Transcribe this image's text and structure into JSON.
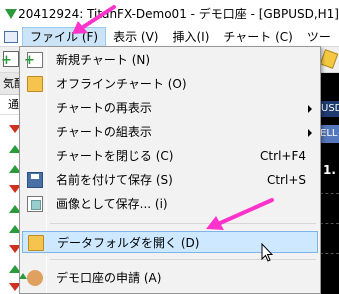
{
  "window": {
    "title": "20412924: TitanFX-Demo01 - デモ口座 - [GBPUSD,H1]"
  },
  "menubar": {
    "items": [
      "ファイル (F)",
      "表示 (V)",
      "挿入(I)",
      "チャート (C)",
      "ツー"
    ]
  },
  "left_panel": {
    "header": "気配",
    "subheader": "通"
  },
  "right_panel": {
    "pair": "USD,H",
    "action": "ELL",
    "value": "1."
  },
  "file_menu": {
    "items": [
      {
        "label": "新規チャート (N)",
        "shortcut": "",
        "icon": "new-chart-icon"
      },
      {
        "label": "オフラインチャート (O)",
        "shortcut": "",
        "icon": "folder-icon"
      },
      {
        "label": "チャートの再表示",
        "shortcut": "",
        "icon": ""
      },
      {
        "label": "チャートの組表示",
        "shortcut": "",
        "icon": ""
      },
      {
        "label": "チャートを閉じる (C)",
        "shortcut": "Ctrl+F4",
        "icon": ""
      },
      {
        "label": "名前を付けて保存 (S)",
        "shortcut": "Ctrl+S",
        "icon": "save-icon"
      },
      {
        "label": "画像として保存... (i)",
        "shortcut": "",
        "icon": "image-icon"
      },
      {
        "label": "データフォルダを開く (D)",
        "shortcut": "",
        "icon": "folder-icon"
      },
      {
        "label": "デモ口座の申請 (A)",
        "shortcut": "",
        "icon": "demo-account-icon"
      }
    ]
  },
  "colors": {
    "accent": "#ff33cc",
    "highlight": "#cde8ff"
  }
}
